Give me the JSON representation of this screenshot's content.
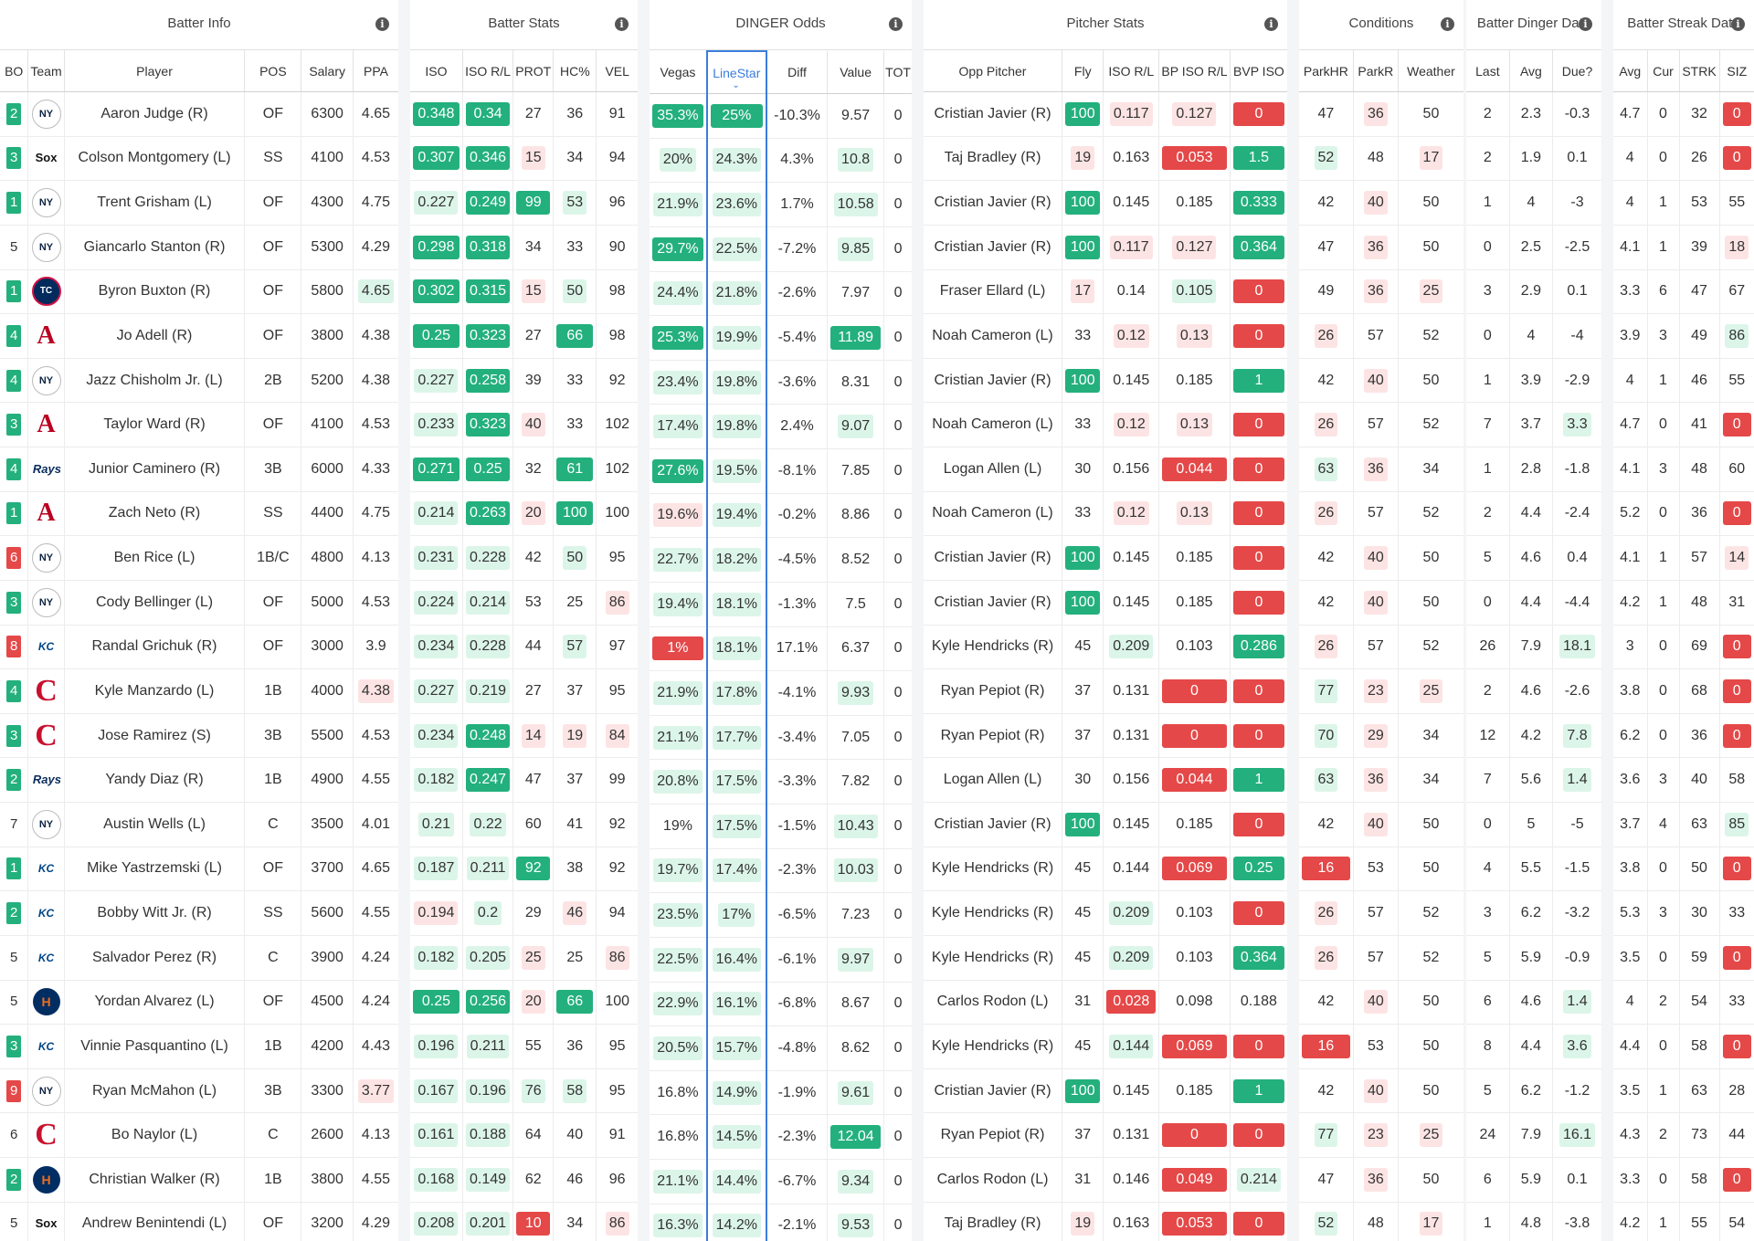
{
  "groups": [
    "Batter Info",
    "Batter Stats",
    "DINGER Odds",
    "Pitcher Stats",
    "Conditions",
    "Batter Dinger Data",
    "Batter Streak Data"
  ],
  "columns": {
    "info": [
      "BO",
      "Team",
      "Player",
      "POS",
      "Salary",
      "PPA"
    ],
    "stats": [
      "ISO",
      "ISO R/L",
      "PROT",
      "HC%",
      "VEL"
    ],
    "odds": [
      "Vegas",
      "LineStar",
      "Diff",
      "Value",
      "TOT"
    ],
    "pitcher": [
      "Opp Pitcher",
      "Fly",
      "ISO R/L",
      "BP ISO R/L",
      "BVP ISO"
    ],
    "conditions": [
      "ParkHR",
      "ParkR",
      "Weather"
    ],
    "dinger": [
      "Last",
      "Avg",
      "Due?"
    ],
    "streak": [
      "Avg",
      "Cur",
      "STRK",
      "SIZ"
    ]
  },
  "team_logos": {
    "NYY": "NY",
    "CWS": "Sox",
    "MIN": "TC",
    "LAA": "A",
    "TB": "Rays",
    "KC": "KC",
    "CLE": "C",
    "HOU": "H"
  },
  "rows": [
    [
      "2",
      "NYY",
      "Aaron Judge (R)",
      "OF",
      "6300",
      "4.65",
      "0.348",
      "0.34",
      "27",
      "36",
      "91",
      "35.3%",
      "25%",
      "-10.3%",
      "9.57",
      "0",
      "Cristian Javier (R)",
      "100",
      "0.117",
      "0.127",
      "0",
      "47",
      "36",
      "50",
      "2",
      "2.3",
      "-0.3",
      "4.7",
      "0",
      "32",
      "0"
    ],
    [
      "3",
      "CWS",
      "Colson Montgomery (L)",
      "SS",
      "4100",
      "4.53",
      "0.307",
      "0.346",
      "15",
      "34",
      "94",
      "20%",
      "24.3%",
      "4.3%",
      "10.8",
      "0",
      "Taj Bradley (R)",
      "19",
      "0.163",
      "0.053",
      "1.5",
      "52",
      "48",
      "17",
      "2",
      "1.9",
      "0.1",
      "4",
      "0",
      "26",
      "0"
    ],
    [
      "1",
      "NYY",
      "Trent Grisham (L)",
      "OF",
      "4300",
      "4.75",
      "0.227",
      "0.249",
      "99",
      "53",
      "96",
      "21.9%",
      "23.6%",
      "1.7%",
      "10.58",
      "0",
      "Cristian Javier (R)",
      "100",
      "0.145",
      "0.185",
      "0.333",
      "42",
      "40",
      "50",
      "1",
      "4",
      "-3",
      "4",
      "1",
      "53",
      "55"
    ],
    [
      "5",
      "NYY",
      "Giancarlo Stanton (R)",
      "OF",
      "5300",
      "4.29",
      "0.298",
      "0.318",
      "34",
      "33",
      "90",
      "29.7%",
      "22.5%",
      "-7.2%",
      "9.85",
      "0",
      "Cristian Javier (R)",
      "100",
      "0.117",
      "0.127",
      "0.364",
      "47",
      "36",
      "50",
      "0",
      "2.5",
      "-2.5",
      "4.1",
      "1",
      "39",
      "18"
    ],
    [
      "1",
      "MIN",
      "Byron Buxton (R)",
      "OF",
      "5800",
      "4.65",
      "0.302",
      "0.315",
      "15",
      "50",
      "98",
      "24.4%",
      "21.8%",
      "-2.6%",
      "7.97",
      "0",
      "Fraser Ellard (L)",
      "17",
      "0.14",
      "0.105",
      "0",
      "49",
      "36",
      "25",
      "3",
      "2.9",
      "0.1",
      "3.3",
      "6",
      "47",
      "67"
    ],
    [
      "4",
      "LAA",
      "Jo Adell (R)",
      "OF",
      "3800",
      "4.38",
      "0.25",
      "0.323",
      "27",
      "66",
      "98",
      "25.3%",
      "19.9%",
      "-5.4%",
      "11.89",
      "0",
      "Noah Cameron (L)",
      "33",
      "0.12",
      "0.13",
      "0",
      "26",
      "57",
      "52",
      "0",
      "4",
      "-4",
      "3.9",
      "3",
      "49",
      "86"
    ],
    [
      "4",
      "NYY",
      "Jazz Chisholm Jr. (L)",
      "2B",
      "5200",
      "4.38",
      "0.227",
      "0.258",
      "39",
      "33",
      "92",
      "23.4%",
      "19.8%",
      "-3.6%",
      "8.31",
      "0",
      "Cristian Javier (R)",
      "100",
      "0.145",
      "0.185",
      "1",
      "42",
      "40",
      "50",
      "1",
      "3.9",
      "-2.9",
      "4",
      "1",
      "46",
      "55"
    ],
    [
      "3",
      "LAA",
      "Taylor Ward (R)",
      "OF",
      "4100",
      "4.53",
      "0.233",
      "0.323",
      "40",
      "33",
      "102",
      "17.4%",
      "19.8%",
      "2.4%",
      "9.07",
      "0",
      "Noah Cameron (L)",
      "33",
      "0.12",
      "0.13",
      "0",
      "26",
      "57",
      "52",
      "7",
      "3.7",
      "3.3",
      "4.7",
      "0",
      "41",
      "0"
    ],
    [
      "4",
      "TB",
      "Junior Caminero (R)",
      "3B",
      "6000",
      "4.33",
      "0.271",
      "0.25",
      "32",
      "61",
      "102",
      "27.6%",
      "19.5%",
      "-8.1%",
      "7.85",
      "0",
      "Logan Allen (L)",
      "30",
      "0.156",
      "0.044",
      "0",
      "63",
      "36",
      "34",
      "1",
      "2.8",
      "-1.8",
      "4.1",
      "3",
      "48",
      "60"
    ],
    [
      "1",
      "LAA",
      "Zach Neto (R)",
      "SS",
      "4400",
      "4.75",
      "0.214",
      "0.263",
      "20",
      "100",
      "100",
      "19.6%",
      "19.4%",
      "-0.2%",
      "8.86",
      "0",
      "Noah Cameron (L)",
      "33",
      "0.12",
      "0.13",
      "0",
      "26",
      "57",
      "52",
      "2",
      "4.4",
      "-2.4",
      "5.2",
      "0",
      "36",
      "0"
    ],
    [
      "6",
      "NYY",
      "Ben Rice (L)",
      "1B/C",
      "4800",
      "4.13",
      "0.231",
      "0.228",
      "42",
      "50",
      "95",
      "22.7%",
      "18.2%",
      "-4.5%",
      "8.52",
      "0",
      "Cristian Javier (R)",
      "100",
      "0.145",
      "0.185",
      "0",
      "42",
      "40",
      "50",
      "5",
      "4.6",
      "0.4",
      "4.1",
      "1",
      "57",
      "14"
    ],
    [
      "3",
      "NYY",
      "Cody Bellinger (L)",
      "OF",
      "5000",
      "4.53",
      "0.224",
      "0.214",
      "53",
      "25",
      "86",
      "19.4%",
      "18.1%",
      "-1.3%",
      "7.5",
      "0",
      "Cristian Javier (R)",
      "100",
      "0.145",
      "0.185",
      "0",
      "42",
      "40",
      "50",
      "0",
      "4.4",
      "-4.4",
      "4.2",
      "1",
      "48",
      "31"
    ],
    [
      "8",
      "KC",
      "Randal Grichuk (R)",
      "OF",
      "3000",
      "3.9",
      "0.234",
      "0.228",
      "44",
      "57",
      "97",
      "1%",
      "18.1%",
      "17.1%",
      "6.37",
      "0",
      "Kyle Hendricks (R)",
      "45",
      "0.209",
      "0.103",
      "0.286",
      "26",
      "57",
      "52",
      "26",
      "7.9",
      "18.1",
      "3",
      "0",
      "69",
      "0"
    ],
    [
      "4",
      "CLE",
      "Kyle Manzardo (L)",
      "1B",
      "4000",
      "4.38",
      "0.227",
      "0.219",
      "27",
      "37",
      "95",
      "21.9%",
      "17.8%",
      "-4.1%",
      "9.93",
      "0",
      "Ryan Pepiot (R)",
      "37",
      "0.131",
      "0",
      "0",
      "77",
      "23",
      "25",
      "2",
      "4.6",
      "-2.6",
      "3.8",
      "0",
      "68",
      "0"
    ],
    [
      "3",
      "CLE",
      "Jose Ramirez (S)",
      "3B",
      "5500",
      "4.53",
      "0.234",
      "0.248",
      "14",
      "19",
      "84",
      "21.1%",
      "17.7%",
      "-3.4%",
      "7.05",
      "0",
      "Ryan Pepiot (R)",
      "37",
      "0.131",
      "0",
      "0",
      "70",
      "29",
      "34",
      "12",
      "4.2",
      "7.8",
      "6.2",
      "0",
      "36",
      "0"
    ],
    [
      "2",
      "TB",
      "Yandy Diaz (R)",
      "1B",
      "4900",
      "4.55",
      "0.182",
      "0.247",
      "47",
      "37",
      "99",
      "20.8%",
      "17.5%",
      "-3.3%",
      "7.82",
      "0",
      "Logan Allen (L)",
      "30",
      "0.156",
      "0.044",
      "1",
      "63",
      "36",
      "34",
      "7",
      "5.6",
      "1.4",
      "3.6",
      "3",
      "40",
      "58"
    ],
    [
      "7",
      "NYY",
      "Austin Wells (L)",
      "C",
      "3500",
      "4.01",
      "0.21",
      "0.22",
      "60",
      "41",
      "92",
      "19%",
      "17.5%",
      "-1.5%",
      "10.43",
      "0",
      "Cristian Javier (R)",
      "100",
      "0.145",
      "0.185",
      "0",
      "42",
      "40",
      "50",
      "0",
      "5",
      "-5",
      "3.7",
      "4",
      "63",
      "85"
    ],
    [
      "1",
      "KC",
      "Mike Yastrzemski (L)",
      "OF",
      "3700",
      "4.65",
      "0.187",
      "0.211",
      "92",
      "38",
      "92",
      "19.7%",
      "17.4%",
      "-2.3%",
      "10.03",
      "0",
      "Kyle Hendricks (R)",
      "45",
      "0.144",
      "0.069",
      "0.25",
      "16",
      "53",
      "50",
      "4",
      "5.5",
      "-1.5",
      "3.8",
      "0",
      "50",
      "0"
    ],
    [
      "2",
      "KC",
      "Bobby Witt Jr. (R)",
      "SS",
      "5600",
      "4.55",
      "0.194",
      "0.2",
      "29",
      "46",
      "94",
      "23.5%",
      "17%",
      "-6.5%",
      "7.23",
      "0",
      "Kyle Hendricks (R)",
      "45",
      "0.209",
      "0.103",
      "0",
      "26",
      "57",
      "52",
      "3",
      "6.2",
      "-3.2",
      "5.3",
      "3",
      "30",
      "33"
    ],
    [
      "5",
      "KC",
      "Salvador Perez (R)",
      "C",
      "3900",
      "4.24",
      "0.182",
      "0.205",
      "25",
      "25",
      "86",
      "22.5%",
      "16.4%",
      "-6.1%",
      "9.97",
      "0",
      "Kyle Hendricks (R)",
      "45",
      "0.209",
      "0.103",
      "0.364",
      "26",
      "57",
      "52",
      "5",
      "5.9",
      "-0.9",
      "3.5",
      "0",
      "59",
      "0"
    ],
    [
      "5",
      "HOU",
      "Yordan Alvarez (L)",
      "OF",
      "4500",
      "4.24",
      "0.25",
      "0.256",
      "20",
      "66",
      "100",
      "22.9%",
      "16.1%",
      "-6.8%",
      "8.67",
      "0",
      "Carlos Rodon (L)",
      "31",
      "0.028",
      "0.098",
      "0.188",
      "42",
      "40",
      "50",
      "6",
      "4.6",
      "1.4",
      "4",
      "2",
      "54",
      "33"
    ],
    [
      "3",
      "KC",
      "Vinnie Pasquantino (L)",
      "1B",
      "4200",
      "4.43",
      "0.196",
      "0.211",
      "55",
      "36",
      "95",
      "20.5%",
      "15.7%",
      "-4.8%",
      "8.62",
      "0",
      "Kyle Hendricks (R)",
      "45",
      "0.144",
      "0.069",
      "0",
      "16",
      "53",
      "50",
      "8",
      "4.4",
      "3.6",
      "4.4",
      "0",
      "58",
      "0"
    ],
    [
      "9",
      "NYY",
      "Ryan McMahon (L)",
      "3B",
      "3300",
      "3.77",
      "0.167",
      "0.196",
      "76",
      "58",
      "95",
      "16.8%",
      "14.9%",
      "-1.9%",
      "9.61",
      "0",
      "Cristian Javier (R)",
      "100",
      "0.145",
      "0.185",
      "1",
      "42",
      "40",
      "50",
      "5",
      "6.2",
      "-1.2",
      "3.5",
      "1",
      "63",
      "28"
    ],
    [
      "6",
      "CLE",
      "Bo Naylor (L)",
      "C",
      "2600",
      "4.13",
      "0.161",
      "0.188",
      "64",
      "40",
      "91",
      "16.8%",
      "14.5%",
      "-2.3%",
      "12.04",
      "0",
      "Ryan Pepiot (R)",
      "37",
      "0.131",
      "0",
      "0",
      "77",
      "23",
      "25",
      "24",
      "7.9",
      "16.1",
      "4.3",
      "2",
      "73",
      "44"
    ],
    [
      "2",
      "HOU",
      "Christian Walker (R)",
      "1B",
      "3800",
      "4.55",
      "0.168",
      "0.149",
      "62",
      "46",
      "96",
      "21.1%",
      "14.4%",
      "-6.7%",
      "9.34",
      "0",
      "Carlos Rodon (L)",
      "31",
      "0.146",
      "0.049",
      "0.214",
      "47",
      "36",
      "50",
      "6",
      "5.9",
      "0.1",
      "3.3",
      "0",
      "58",
      "0"
    ],
    [
      "5",
      "CWS",
      "Andrew Benintendi (L)",
      "OF",
      "3200",
      "4.29",
      "0.208",
      "0.201",
      "10",
      "34",
      "86",
      "16.3%",
      "14.2%",
      "-2.1%",
      "9.53",
      "0",
      "Taj Bradley (R)",
      "19",
      "0.163",
      "0.053",
      "0",
      "52",
      "48",
      "17",
      "1",
      "4.8",
      "-3.8",
      "4.2",
      "1",
      "55",
      "54"
    ]
  ],
  "styles": [
    {
      "0": "bo-g",
      "6": "dg",
      "7": "dg",
      "11": "dg",
      "12": "dg",
      "17": "dg",
      "18": "lr",
      "19": "lr",
      "20": "dr",
      "22": "lr",
      "30": "dr"
    },
    {
      "0": "bo-g",
      "6": "dg",
      "7": "dg",
      "8": "lr",
      "11": "lg",
      "12": "lg",
      "14": "lg",
      "17": "lr",
      "19": "dr",
      "20": "dg",
      "21": "lg",
      "23": "lr",
      "30": "dr"
    },
    {
      "0": "bo-g",
      "6": "lg",
      "7": "dg",
      "8": "dg",
      "9": "lg",
      "11": "lg",
      "12": "lg",
      "14": "lg",
      "17": "dg",
      "20": "dg",
      "22": "lr"
    },
    {
      "6": "dg",
      "7": "dg",
      "11": "dg",
      "12": "lg",
      "14": "lg",
      "17": "dg",
      "18": "lr",
      "19": "lr",
      "20": "dg",
      "22": "lr",
      "30": "lr"
    },
    {
      "0": "bo-g",
      "5": "lg",
      "6": "dg",
      "7": "dg",
      "8": "lr",
      "9": "lg",
      "11": "lg",
      "12": "lg",
      "17": "lr",
      "19": "lg",
      "20": "dr",
      "22": "lr",
      "23": "lr"
    },
    {
      "0": "bo-g",
      "6": "dg",
      "7": "dg",
      "9": "dg",
      "11": "dg",
      "12": "lg",
      "14": "dg",
      "18": "lr",
      "19": "lr",
      "20": "dr",
      "21": "lr",
      "30": "lg"
    },
    {
      "0": "bo-g",
      "6": "lg",
      "7": "dg",
      "11": "lg",
      "12": "lg",
      "17": "dg",
      "20": "dg",
      "22": "lr"
    },
    {
      "0": "bo-g",
      "6": "lg",
      "7": "dg",
      "8": "lr",
      "11": "lg",
      "12": "lg",
      "14": "lg",
      "18": "lr",
      "19": "lr",
      "20": "dr",
      "21": "lr",
      "26": "lg",
      "30": "dr"
    },
    {
      "0": "bo-g",
      "6": "dg",
      "7": "dg",
      "9": "dg",
      "11": "dg",
      "12": "lg",
      "19": "dr",
      "20": "dr",
      "21": "lg",
      "22": "lr"
    },
    {
      "0": "bo-g",
      "6": "lg",
      "7": "dg",
      "8": "lr",
      "9": "dg",
      "11": "lr",
      "12": "lg",
      "18": "lr",
      "19": "lr",
      "20": "dr",
      "21": "lr",
      "30": "dr"
    },
    {
      "0": "bo-r",
      "6": "lg",
      "7": "lg",
      "9": "lg",
      "11": "lg",
      "12": "lg",
      "17": "dg",
      "20": "dr",
      "22": "lr",
      "30": "lr"
    },
    {
      "0": "bo-g",
      "6": "lg",
      "7": "lg",
      "10": "lr",
      "11": "lg",
      "12": "lg",
      "17": "dg",
      "20": "dr",
      "22": "lr"
    },
    {
      "0": "bo-r",
      "6": "lg",
      "7": "lg",
      "9": "lg",
      "11": "dr",
      "12": "lg",
      "18": "lg",
      "20": "dg",
      "21": "lr",
      "26": "lg",
      "30": "dr"
    },
    {
      "0": "bo-g",
      "5": "lr",
      "6": "lg",
      "7": "lg",
      "11": "lg",
      "12": "lg",
      "14": "lg",
      "19": "dr",
      "20": "dr",
      "21": "lg",
      "22": "lr",
      "23": "lr",
      "30": "dr"
    },
    {
      "0": "bo-g",
      "6": "lg",
      "7": "dg",
      "8": "lr",
      "9": "lr",
      "10": "lr",
      "11": "lg",
      "12": "lg",
      "19": "dr",
      "20": "dr",
      "21": "lg",
      "22": "lr",
      "26": "lg",
      "30": "dr"
    },
    {
      "0": "bo-g",
      "6": "lg",
      "7": "dg",
      "11": "lg",
      "12": "lg",
      "19": "dr",
      "20": "dg",
      "21": "lg",
      "22": "lr",
      "26": "lg"
    },
    {
      "6": "lg",
      "7": "lg",
      "12": "lg",
      "14": "lg",
      "17": "dg",
      "20": "dr",
      "22": "lr",
      "30": "lg"
    },
    {
      "0": "bo-g",
      "6": "lg",
      "7": "lg",
      "8": "dg",
      "11": "lg",
      "12": "lg",
      "14": "lg",
      "19": "dr",
      "20": "dg",
      "21": "dr",
      "30": "dr"
    },
    {
      "0": "bo-g",
      "6": "lr",
      "7": "lg",
      "9": "lr",
      "11": "lg",
      "12": "lg",
      "18": "lg",
      "20": "dr",
      "21": "lr"
    },
    {
      "6": "lg",
      "7": "lg",
      "8": "lr",
      "10": "lr",
      "11": "lg",
      "12": "lg",
      "14": "lg",
      "18": "lg",
      "20": "dg",
      "21": "lr",
      "30": "dr"
    },
    {
      "6": "dg",
      "7": "dg",
      "8": "lr",
      "9": "dg",
      "11": "lg",
      "12": "lg",
      "18": "dr",
      "22": "lr",
      "26": "lg"
    },
    {
      "0": "bo-g",
      "6": "lg",
      "7": "lg",
      "11": "lg",
      "12": "lg",
      "18": "lg",
      "19": "dr",
      "20": "dr",
      "21": "dr",
      "26": "lg",
      "30": "dr"
    },
    {
      "0": "bo-r",
      "5": "lr",
      "6": "lg",
      "7": "lg",
      "8": "lg",
      "9": "lg",
      "12": "lg",
      "14": "lg",
      "17": "dg",
      "20": "dg",
      "22": "lr"
    },
    {
      "6": "lg",
      "7": "lg",
      "12": "lg",
      "14": "dg",
      "19": "dr",
      "20": "dr",
      "21": "lg",
      "22": "lr",
      "23": "lr",
      "26": "lg"
    },
    {
      "0": "bo-g",
      "6": "lg",
      "7": "lg",
      "11": "lg",
      "12": "lg",
      "14": "lg",
      "19": "dr",
      "20": "lg",
      "22": "lr",
      "30": "dr"
    },
    {
      "6": "lg",
      "7": "lg",
      "8": "dr",
      "10": "lr",
      "11": "lg",
      "12": "lg",
      "14": "lg",
      "17": "lr",
      "19": "dr",
      "20": "dr",
      "21": "lg",
      "23": "lr"
    }
  ]
}
